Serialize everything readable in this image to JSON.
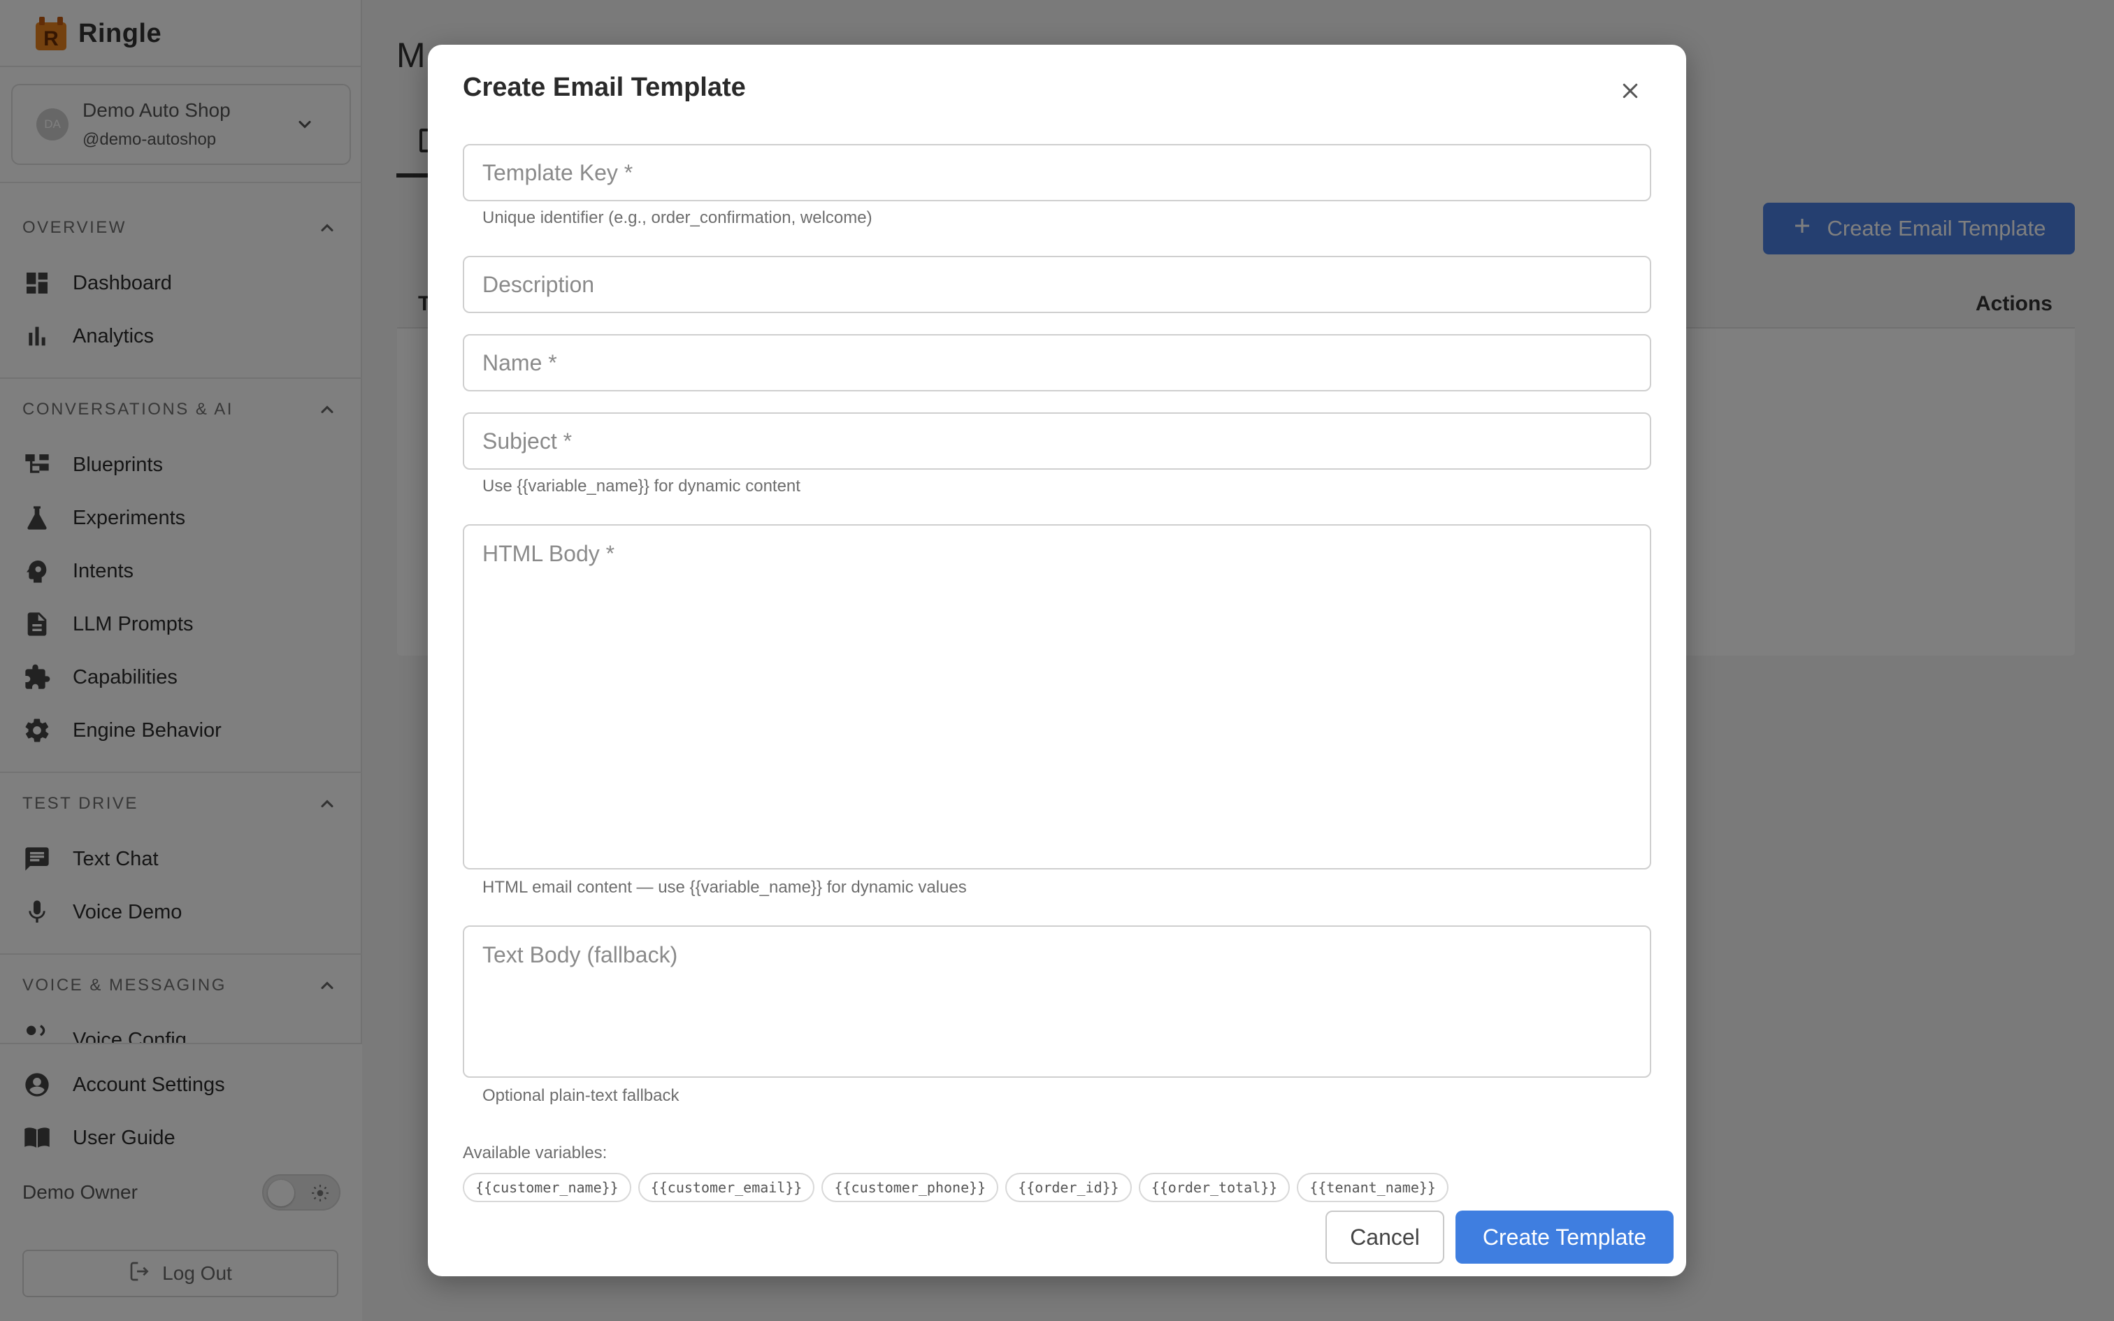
{
  "app": {
    "brand_name": "Ringle",
    "logo_letter": "R"
  },
  "tenant": {
    "avatar_initials": "DA",
    "name": "Demo Auto Shop",
    "handle": "@demo-autoshop"
  },
  "sidebar": {
    "sections": [
      {
        "title": "OVERVIEW",
        "items": [
          {
            "label": "Dashboard",
            "icon": "dashboard-icon"
          },
          {
            "label": "Analytics",
            "icon": "bar-chart-icon"
          }
        ]
      },
      {
        "title": "CONVERSATIONS & AI",
        "items": [
          {
            "label": "Blueprints",
            "icon": "hierarchy-icon"
          },
          {
            "label": "Experiments",
            "icon": "flask-icon"
          },
          {
            "label": "Intents",
            "icon": "psychology-icon"
          },
          {
            "label": "LLM Prompts",
            "icon": "document-icon"
          },
          {
            "label": "Capabilities",
            "icon": "puzzle-icon"
          },
          {
            "label": "Engine Behavior",
            "icon": "gear-icon"
          }
        ]
      },
      {
        "title": "TEST DRIVE",
        "items": [
          {
            "label": "Text Chat",
            "icon": "chat-icon"
          },
          {
            "label": "Voice Demo",
            "icon": "microphone-icon"
          }
        ]
      },
      {
        "title": "VOICE & MESSAGING",
        "items": [
          {
            "label": "Voice Config",
            "icon": "voice-icon"
          }
        ]
      }
    ],
    "bottom": {
      "account_settings": "Account Settings",
      "user_guide": "User Guide",
      "owner_name": "Demo Owner",
      "logout": "Log Out"
    }
  },
  "main": {
    "title_visible": "M",
    "create_button": "Create Email Template",
    "table": {
      "first_header": "T",
      "actions_header": "Actions"
    }
  },
  "modal": {
    "title": "Create Email Template",
    "fields": {
      "template_key": {
        "placeholder": "Template Key *",
        "helper": "Unique identifier (e.g., order_confirmation, welcome)"
      },
      "description": {
        "placeholder": "Description"
      },
      "name": {
        "placeholder": "Name *"
      },
      "subject": {
        "placeholder": "Subject *",
        "helper": "Use {{variable_name}} for dynamic content"
      },
      "html_body": {
        "placeholder": "HTML Body *",
        "helper": "HTML email content — use {{variable_name}} for dynamic values"
      },
      "text_body": {
        "placeholder": "Text Body (fallback)",
        "helper": "Optional plain-text fallback"
      }
    },
    "variables_label": "Available variables:",
    "variables": [
      "{{customer_name}}",
      "{{customer_email}}",
      "{{customer_phone}}",
      "{{order_id}}",
      "{{order_total}}",
      "{{tenant_name}}"
    ],
    "cancel_label": "Cancel",
    "submit_label": "Create Template"
  },
  "colors": {
    "primary": "#3f7ee0",
    "logo_orange": "#e8821e",
    "overlay": "rgba(0,0,0,0.5)"
  }
}
